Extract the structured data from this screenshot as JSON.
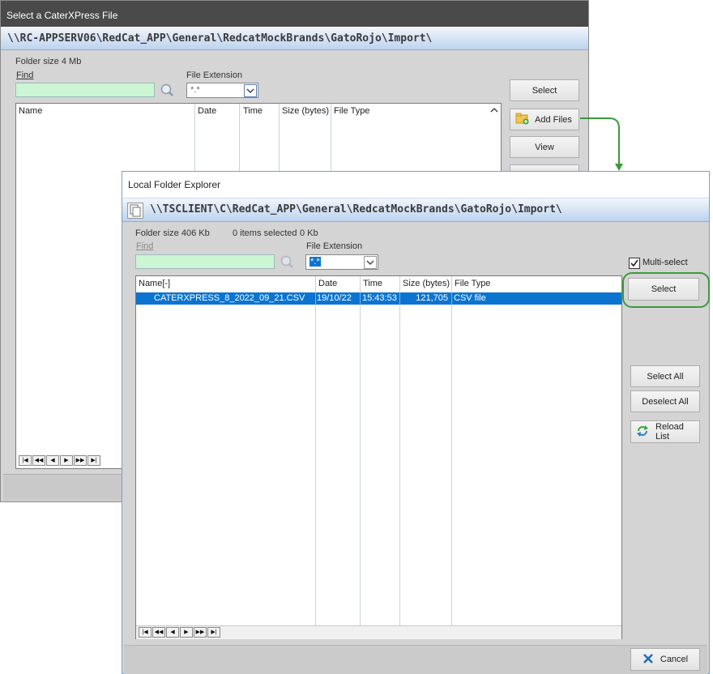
{
  "back_window": {
    "title": "Select a CaterXPress File",
    "path": "\\\\RC-APPSERV06\\RedCat_APP\\General\\RedcatMockBrands\\GatoRojo\\Import\\",
    "folder_size": "Folder size 4 Mb",
    "find_label": "Find",
    "file_extension_label": "File Extension",
    "file_extension_value": "*.*",
    "columns": [
      "Name",
      "Date",
      "Time",
      "Size (bytes)",
      "File Type"
    ],
    "buttons": {
      "select": "Select",
      "add_files": "Add Files",
      "view": "View"
    }
  },
  "front_window": {
    "title": "Local Folder Explorer",
    "path": "\\\\TSCLIENT\\C\\RedCat_APP\\General\\RedcatMockBrands\\GatoRojo\\Import\\",
    "folder_size": "Folder size 406 Kb",
    "items_selected": "0 items selected",
    "selected_size": "0 Kb",
    "find_label": "Find",
    "file_extension_label": "File Extension",
    "file_extension_value": "*.*",
    "multi_select_label": "Multi-select",
    "multi_select_checked": true,
    "columns": [
      "Name[-]",
      "Date",
      "Time",
      "Size (bytes)",
      "File Type"
    ],
    "rows": [
      {
        "name": "CATERXPRESS_8_2022_09_21.CSV",
        "date": "19/10/22",
        "time": "15:43:53",
        "size": "121,705",
        "type": "CSV file"
      }
    ],
    "buttons": {
      "select": "Select",
      "select_all": "Select All",
      "deselect_all": "Deselect All",
      "reload_list": "Reload List",
      "cancel": "Cancel"
    }
  },
  "colors": {
    "accent_green": "#3b9a3b",
    "selection_blue": "#0b74d0",
    "find_bg": "#ccf5d4"
  }
}
